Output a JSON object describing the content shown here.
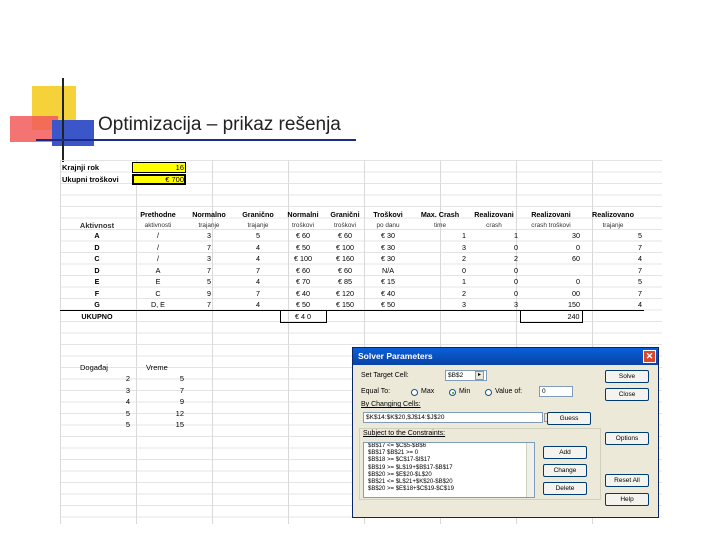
{
  "slide": {
    "title": "Optimizacija – prikaz rešenja"
  },
  "top": [
    {
      "label": "Krajnji rok",
      "value": "16"
    },
    {
      "label": "Ukupni troškovi",
      "value": "€ 700"
    }
  ],
  "table": {
    "headers": [
      "Aktivnost",
      "Prethodne",
      "Normalno",
      "Granično",
      "Normalni",
      "Granični",
      "Troškovi",
      "Max. Crash",
      "Realizovani",
      "Realizovani",
      "Realizovano"
    ],
    "subheaders": [
      "",
      "aktivnosti",
      "trajanje",
      "trajanje",
      "troškovi",
      "troškovi",
      "po danu",
      "time",
      "crash",
      "crash troškovi",
      "trajanje"
    ],
    "rows": [
      [
        "A",
        "/",
        "3",
        "5",
        "€ 60",
        "€ 60",
        "€ 30",
        "1",
        "1",
        "30",
        "5"
      ],
      [
        "D",
        "/",
        "7",
        "4",
        "€ 50",
        "€ 100",
        "€ 30",
        "3",
        "0",
        "0",
        "7"
      ],
      [
        "C",
        "/",
        "3",
        "4",
        "€ 100",
        "€ 160",
        "€ 30",
        "2",
        "2",
        "60",
        "4"
      ],
      [
        "D",
        "A",
        "7",
        "7",
        "€ 60",
        "€ 60",
        "N/A",
        "0",
        "0",
        "",
        "7"
      ],
      [
        "E",
        "E",
        "5",
        "4",
        "€ 70",
        "€ 85",
        "€ 15",
        "1",
        "0",
        "0",
        "5"
      ],
      [
        "F",
        "C",
        "9",
        "7",
        "€ 40",
        "€ 120",
        "€ 40",
        "2",
        "0",
        "00",
        "7"
      ],
      [
        "G",
        "D, E",
        "7",
        "4",
        "€ 50",
        "€ 150",
        "€ 50",
        "3",
        "3",
        "150",
        "4"
      ]
    ],
    "total_label": "UKUPNO",
    "total_normal_cost": "€ 4 0",
    "total_crash_cost": "240"
  },
  "events": {
    "headers": [
      "Događaj",
      "Vreme"
    ],
    "rows": [
      [
        "2",
        "5"
      ],
      [
        "3",
        "7"
      ],
      [
        "4",
        "9"
      ],
      [
        "5",
        "12"
      ],
      [
        "5",
        "15"
      ]
    ]
  },
  "solver": {
    "title": "Solver Parameters",
    "close": "✕",
    "set_target_label": "Set Target Cell:",
    "set_target_value": "$B$2",
    "equal_to_label": "Equal To:",
    "opt_max": "Max",
    "opt_min": "Min",
    "opt_value": "Value of:",
    "value_of": "0",
    "changing_label": "By Changing Cells:",
    "changing_value": "$K$14:$K$20,$J$14:$J$20",
    "constraints_label": "Subject to the Constraints:",
    "constraints": [
      "$B$17 <= $C$5-$B$6",
      "$B$17 $B$21 >= 0",
      "$B$18 >= $C$17-$I$17",
      "$B$19 >= $L$19+$B$17-$B$17",
      "$B$20 >= $E$20-$L$20",
      "$B$21 <= $L$21+$K$20-$B$20",
      "$B$20 >= $E$18+$C$19-$C$19"
    ],
    "buttons": {
      "solve": "Solve",
      "close": "Close",
      "guess": "Guess",
      "options": "Options",
      "add": "Add",
      "change": "Change",
      "delete": "Delete",
      "reset": "Reset All",
      "help": "Help"
    }
  },
  "colors": {
    "accent_yellow": "#ffff00",
    "title_bar": "#0a5fd8",
    "dialog_bg": "#ece9d8"
  }
}
